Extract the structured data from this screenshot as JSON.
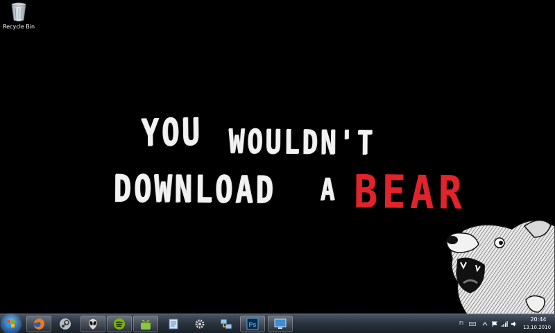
{
  "desktop": {
    "icons": [
      {
        "label": "Recycle Bin",
        "icon": "recycle-bin-icon"
      }
    ]
  },
  "wallpaper": {
    "line1": [
      "YOU",
      "WOULDN'T"
    ],
    "line2": [
      "DOWNLOAD",
      "A",
      "BEAR"
    ],
    "text_color": "#f2f2f2",
    "accent_color": "#e0242a"
  },
  "taskbar": {
    "start": {
      "icon": "windows-orb-icon"
    },
    "items": [
      {
        "name": "firefox",
        "icon": "firefox-icon",
        "active": true
      },
      {
        "name": "steam",
        "icon": "steam-icon",
        "active": false
      },
      {
        "name": "alien",
        "icon": "alien-icon",
        "active": true
      },
      {
        "name": "spotify",
        "icon": "spotify-icon",
        "active": true
      },
      {
        "name": "sprout",
        "icon": "sprout-icon",
        "active": true
      },
      {
        "name": "notepad",
        "icon": "notepad-icon",
        "active": false
      },
      {
        "name": "settings",
        "icon": "gear-icon",
        "active": false
      },
      {
        "name": "network",
        "icon": "network-icon",
        "active": false
      },
      {
        "name": "photoshop",
        "icon": "photoshop-icon",
        "label": "Ps",
        "active": true
      },
      {
        "name": "remote-desktop",
        "icon": "monitor-icon",
        "active": true
      }
    ],
    "tray": {
      "language": "FI",
      "icons": [
        "keyboard-icon",
        "chevron-up-icon",
        "flag-icon",
        "network-signal-icon",
        "volume-icon"
      ],
      "time": "20:44",
      "date": "13.10.2010"
    }
  }
}
